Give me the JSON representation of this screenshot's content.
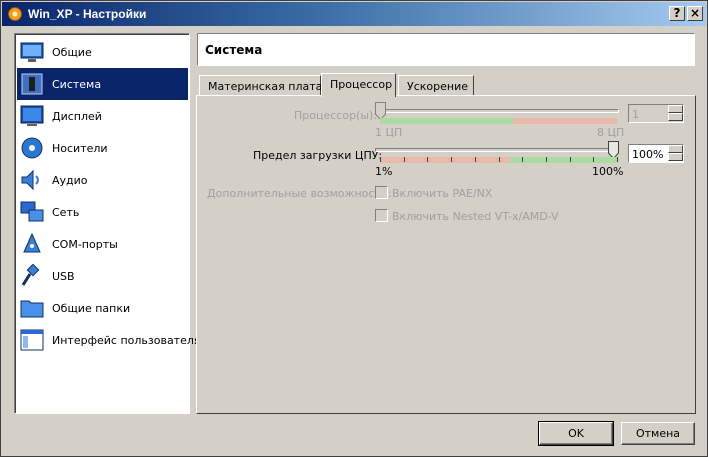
{
  "window": {
    "title": "Win_XP - Настройки"
  },
  "titlebar": {
    "help_glyph": "?",
    "close_glyph": "×"
  },
  "sidebar": {
    "items": [
      {
        "label": "Общие",
        "icon": "monitor-icon"
      },
      {
        "label": "Система",
        "icon": "chip-icon",
        "selected": true
      },
      {
        "label": "Дисплей",
        "icon": "display-icon"
      },
      {
        "label": "Носители",
        "icon": "disc-icon"
      },
      {
        "label": "Аудио",
        "icon": "speaker-icon"
      },
      {
        "label": "Сеть",
        "icon": "network-icon"
      },
      {
        "label": "COM-порты",
        "icon": "serial-port-icon"
      },
      {
        "label": "USB",
        "icon": "usb-icon"
      },
      {
        "label": "Общие папки",
        "icon": "folder-icon"
      },
      {
        "label": "Интерфейс пользователя",
        "icon": "window-icon"
      }
    ]
  },
  "header": {
    "title": "Система"
  },
  "tabs": [
    {
      "label": "Материнская плата"
    },
    {
      "label": "Процессор",
      "active": true
    },
    {
      "label": "Ускорение"
    }
  ],
  "processor": {
    "cpus_label": "Процессор(ы):",
    "cpus_min": "1 ЦП",
    "cpus_max": "8 ЦП",
    "cpus_value": "1",
    "cpus_level": 0,
    "cap_label": "Предел загрузки ЦПУ:",
    "cap_min": "1%",
    "cap_max": "100%",
    "cap_value": "100%",
    "cap_level": 1,
    "extended_label": "Дополнительные возможности:",
    "pae_label": "Включить PAE/NX",
    "pae_checked": false,
    "nested_label": "Включить Nested VT-x/AMD-V",
    "nested_checked": false
  },
  "footer": {
    "ok_label": "OK",
    "cancel_label": "Отмена"
  },
  "colors": {
    "title_start": "#0a246a",
    "title_end": "#a6caf0",
    "selection": "#0a246a",
    "green_bar": "#a8dca0",
    "red_bar": "#e8b8a8"
  }
}
